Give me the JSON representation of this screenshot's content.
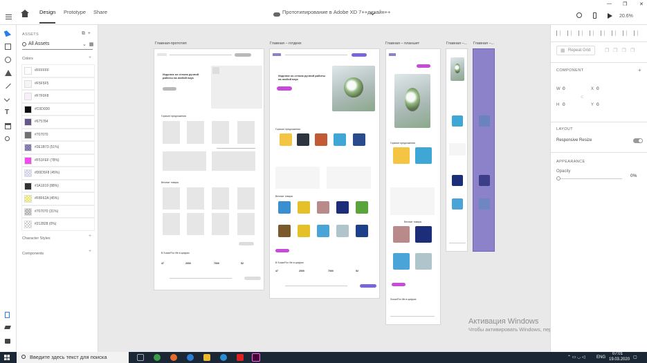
{
  "titlebar": {
    "tabs": [
      "Design",
      "Prototype",
      "Share"
    ],
    "doc_title": "Прототипирование в Adobe XD 7++дизайн++",
    "zoom": "20.6%",
    "win_min": "—",
    "win_max": "❐",
    "win_close": "✕"
  },
  "assets": {
    "header": "ASSETS",
    "filter": "All Assets",
    "colors_title": "Colors",
    "char_styles": "Character Styles",
    "components": "Components",
    "colors": [
      {
        "label": "#FFFFFF",
        "hex": "#FFFFFF"
      },
      {
        "label": "#F5F5F5",
        "hex": "#F5F5F5"
      },
      {
        "label": "#F7F0F8",
        "hex": "#F7F0F8"
      },
      {
        "label": "#C0D0D0",
        "hex": "#0C0D0D"
      },
      {
        "label": "#675784",
        "hex": "#675784"
      },
      {
        "label": "#707070",
        "hex": "#707070"
      },
      {
        "label": "#2E1B73 (51%)",
        "hex": "#2E1B73"
      },
      {
        "label": "#F51FEF (78%)",
        "hex": "#F51FEF"
      },
      {
        "label": "#D0D5F8 (45%)",
        "hex": "#D0D5F8"
      },
      {
        "label": "#1A1919 (88%)",
        "hex": "#1A1919"
      },
      {
        "label": "#F8F62A (45%)",
        "hex": "#F8F62A"
      },
      {
        "label": "#707070 (31%)",
        "hex": "#707070"
      },
      {
        "label": "#212828 (0%)",
        "hex": "#212828"
      }
    ]
  },
  "canvas": {
    "artboards": [
      {
        "label": "Главная-прототип"
      },
      {
        "label": "Главная – готдекх"
      },
      {
        "label": "Главная – планшет"
      },
      {
        "label": "Главная –..."
      },
      {
        "label": "Главная –..."
      }
    ],
    "ab1": {
      "heading": "Изделие из стекла ручной работы на любой вкус",
      "section1": "Горячие предложения",
      "section2": "Вечные товары",
      "stats_title": "В SusanFlor life в цифрах",
      "stats": [
        "47",
        "2000",
        "7000",
        "52"
      ]
    },
    "ab2": {
      "heading": "Изделие из стекла ручной работы на любой вкус",
      "section1": "Горячие предложения",
      "section2": "Вечные товары",
      "stats_title": "В SusanFlor life в цифрах",
      "stats": [
        "47",
        "2000",
        "7000",
        "52"
      ]
    },
    "ab3": {
      "section1": "Горячие предложения",
      "section2": "Вечные товары",
      "stats_title": "SusanFlor life в цифрах"
    },
    "activation_title": "Активация Windows",
    "activation_sub": "Чтобы активировать Windows, перейдите в раздел \"Параметры\"."
  },
  "props": {
    "repeat_grid": "Repeat Grid",
    "component": "COMPONENT",
    "w_label": "W",
    "w_value": "0",
    "h_label": "H",
    "h_value": "0",
    "x_label": "X",
    "x_value": "0",
    "y_label": "Y",
    "y_value": "0",
    "layout": "LAYOUT",
    "responsive": "Responsive Resize",
    "appearance": "APPEARANCE",
    "opacity": "Opacity",
    "opacity_value": "0%"
  },
  "taskbar": {
    "search_placeholder": "Введите здесь текст для поиска",
    "lang": "ENG",
    "time": "07:01",
    "date": "19.03.2020"
  }
}
